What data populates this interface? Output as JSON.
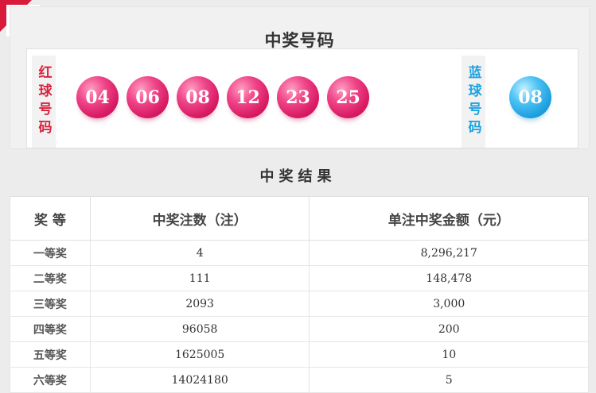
{
  "header": {
    "title": "中奖号码",
    "red_label": "红球号码",
    "blue_label": "蓝球号码"
  },
  "red_balls": [
    "04",
    "06",
    "08",
    "12",
    "23",
    "25"
  ],
  "blue_ball": "08",
  "results": {
    "title": "中奖结果",
    "columns": [
      "奖 等",
      "中奖注数（注）",
      "单注中奖金额（元）"
    ],
    "rows": [
      {
        "level": "一等奖",
        "count": "4",
        "amount": "8,296,217"
      },
      {
        "level": "二等奖",
        "count": "111",
        "amount": "148,478"
      },
      {
        "level": "三等奖",
        "count": "2093",
        "amount": "3,000"
      },
      {
        "level": "四等奖",
        "count": "96058",
        "amount": "200"
      },
      {
        "level": "五等奖",
        "count": "1625005",
        "amount": "10"
      },
      {
        "level": "六等奖",
        "count": "14024180",
        "amount": "5"
      }
    ]
  },
  "colors": {
    "red_ball": "#e0306f",
    "blue_ball": "#2aa7e2",
    "red_label": "#d9233f",
    "blue_label": "#1fa3e0",
    "accent": "#d81b3a"
  }
}
